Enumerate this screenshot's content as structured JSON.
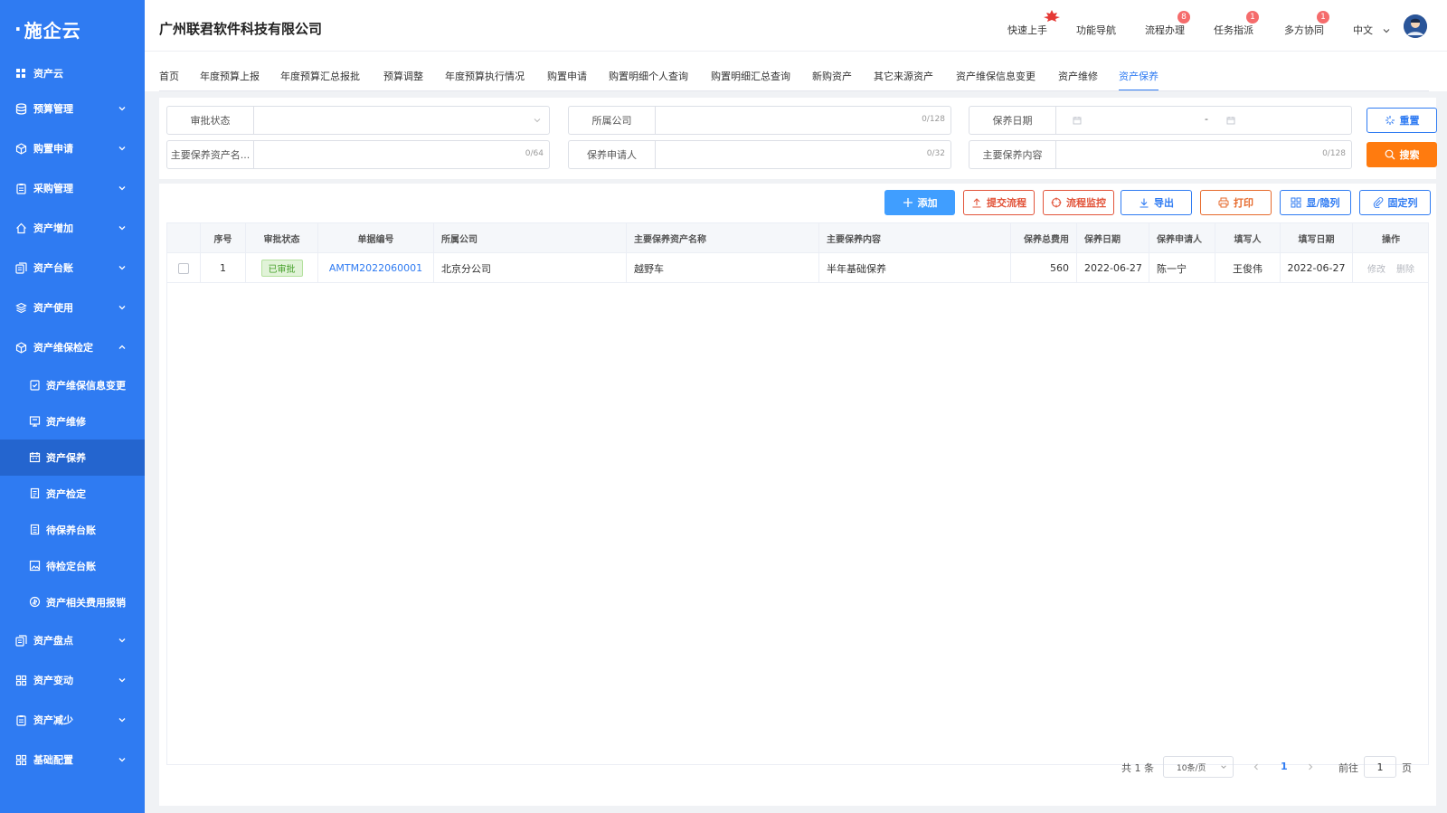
{
  "logo": {
    "text": "施企云"
  },
  "sidebar": {
    "items": [
      {
        "label": "资产云",
        "icon": "grid-icon"
      },
      {
        "label": "预算管理",
        "icon": "database-icon"
      },
      {
        "label": "购置申请",
        "icon": "cube-icon"
      },
      {
        "label": "采购管理",
        "icon": "clipboard-icon"
      },
      {
        "label": "资产增加",
        "icon": "home-icon"
      },
      {
        "label": "资产台账",
        "icon": "ledger-icon"
      },
      {
        "label": "资产使用",
        "icon": "layers-icon"
      },
      {
        "label": "资产维保检定",
        "icon": "cube-icon"
      }
    ],
    "sub_items": [
      {
        "label": "资产维保信息变更"
      },
      {
        "label": "资产维修"
      },
      {
        "label": "资产保养"
      },
      {
        "label": "资产检定"
      },
      {
        "label": "待保养台账"
      },
      {
        "label": "待检定台账"
      },
      {
        "label": "资产相关费用报销"
      }
    ],
    "bottom_items": [
      {
        "label": "资产盘点"
      },
      {
        "label": "资产变动"
      },
      {
        "label": "资产减少"
      },
      {
        "label": "基础配置"
      }
    ]
  },
  "header": {
    "company": "广州联君软件科技有限公司",
    "links": [
      {
        "label": "快速上手",
        "badge": "HOT"
      },
      {
        "label": "功能导航",
        "badge": ""
      },
      {
        "label": "流程办理",
        "badge": "8"
      },
      {
        "label": "任务指派",
        "badge": "1"
      },
      {
        "label": "多方协同",
        "badge": "1"
      }
    ],
    "language": "中文"
  },
  "tabs": [
    "首页",
    "年度预算上报",
    "年度预算汇总报批",
    "预算调整",
    "年度预算执行情况",
    "购置申请",
    "购置明细个人查询",
    "购置明细汇总查询",
    "新购资产",
    "其它来源资产",
    "资产维保信息变更",
    "资产维修",
    "资产保养"
  ],
  "filters": {
    "approval_status": {
      "label": "审批状态",
      "value": ""
    },
    "company": {
      "label": "所属公司",
      "count": "0/128"
    },
    "date": {
      "label": "保养日期",
      "sep": "-"
    },
    "asset_name": {
      "label": "主要保养资产名...",
      "count": "0/64"
    },
    "applicant": {
      "label": "保养申请人",
      "count": "0/32"
    },
    "content": {
      "label": "主要保养内容",
      "count": "0/128"
    },
    "reset_label": "重置",
    "search_label": "搜索"
  },
  "toolbar": {
    "add": "添加",
    "submit": "提交流程",
    "monitor": "流程监控",
    "export": "导出",
    "print": "打印",
    "toggle_cols": "显/隐列",
    "fix_cols": "固定列"
  },
  "table": {
    "headers": [
      "序号",
      "审批状态",
      "单据编号",
      "所属公司",
      "主要保养资产名称",
      "主要保养内容",
      "保养总费用",
      "保养日期",
      "保养申请人",
      "填写人",
      "填写日期",
      "操作"
    ],
    "rows": [
      {
        "index": "1",
        "status": "已审批",
        "code": "AMTM2022060001",
        "company": "北京分公司",
        "asset": "越野车",
        "content": "半年基础保养",
        "cost": "560",
        "date": "2022-06-27",
        "applicant": "陈一宁",
        "writer": "王俊伟",
        "write_date": "2022-06-27",
        "edit": "修改",
        "delete": "删除"
      }
    ]
  },
  "pagination": {
    "total": "共 1 条",
    "page_size": "10条/页",
    "current": "1",
    "goto_prefix": "前往",
    "goto_value": "1",
    "goto_suffix": "页"
  },
  "colors": {
    "sidebar": "#2f7bf2",
    "sidebar_active": "#2465cf",
    "primary": "#2f7bf2",
    "orange": "#ff7b0f",
    "success": "#45a02a"
  }
}
